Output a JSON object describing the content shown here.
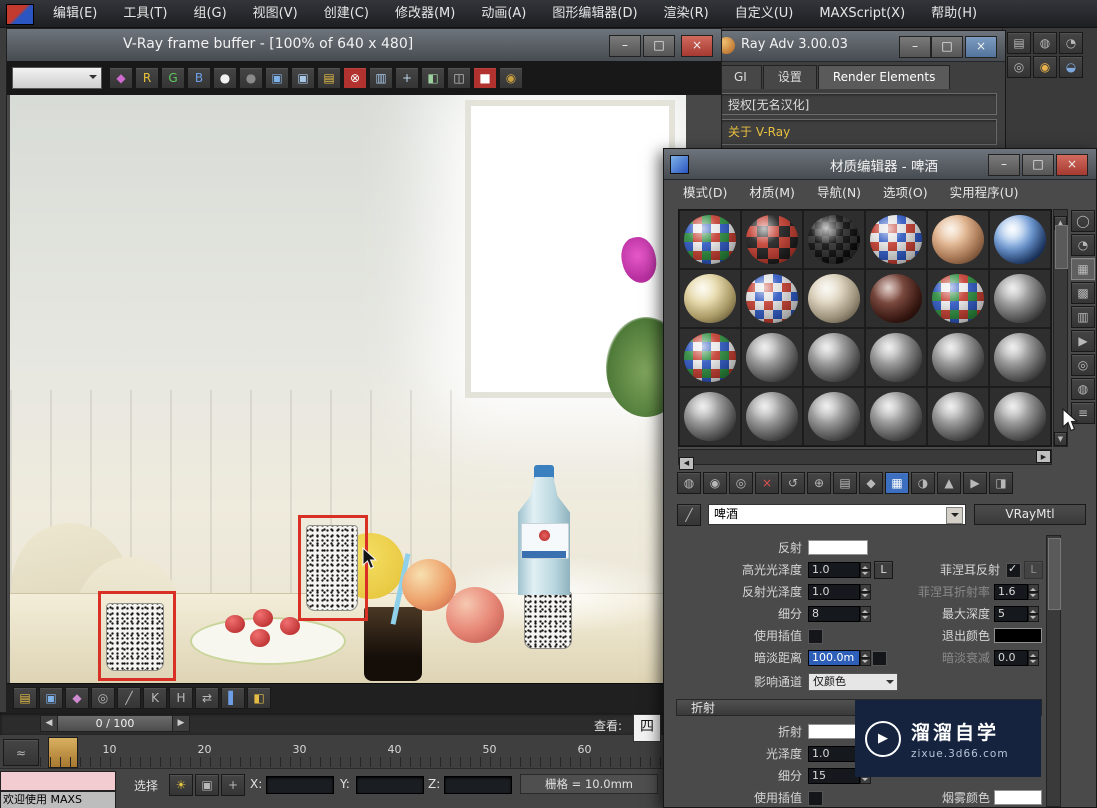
{
  "colors": {
    "accent_red": "#d93025",
    "selection_blue": "#2e5fb8",
    "watermark_bg": "#15233f"
  },
  "menubar": {
    "items": [
      "编辑(E)",
      "工具(T)",
      "组(G)",
      "视图(V)",
      "创建(C)",
      "修改器(M)",
      "动画(A)",
      "图形编辑器(D)",
      "渲染(R)",
      "自定义(U)",
      "MAXScript(X)",
      "帮助(H)"
    ]
  },
  "topright": {
    "icons": [
      {
        "name": "manage-layers-icon",
        "glyph": "▤"
      },
      {
        "name": "material-editor-icon",
        "glyph": "◍"
      },
      {
        "name": "arc-rotate-icon",
        "glyph": "◔"
      },
      {
        "name": "render-setup-icon",
        "glyph": "◎"
      },
      {
        "name": "render-production-icon",
        "glyph": "◉",
        "fg": "#e8b24a"
      },
      {
        "name": "render-iterative-icon",
        "glyph": "◒",
        "fg": "#7fa8e0"
      }
    ]
  },
  "vray": {
    "title": "Ray Adv 3.00.03",
    "buttons": {
      "min": "–",
      "max": "□",
      "close": "×"
    },
    "tabs": [
      "GI",
      "设置",
      "Render Elements"
    ],
    "license": "授权[无名汉化]",
    "about": "关于 V-Ray"
  },
  "framebuffer": {
    "title": "V-Ray frame buffer - [100% of 640 x 480]",
    "buttons": {
      "min": "–",
      "max": "□",
      "close": "×"
    },
    "toolbar": [
      {
        "name": "color-corrections-icon",
        "glyph": "◆",
        "fg": "#d06ad0"
      },
      {
        "name": "red-channel-button",
        "glyph": "R",
        "fg": "#e8c23a"
      },
      {
        "name": "green-channel-button",
        "glyph": "G",
        "fg": "#5fc75f"
      },
      {
        "name": "blue-channel-button",
        "glyph": "B",
        "fg": "#6d9fe8"
      },
      {
        "name": "monochromatic-button",
        "glyph": "●",
        "fg": "#f2f2f2"
      },
      {
        "name": "alpha-channel-button",
        "glyph": "●",
        "fg": "#8a8a8a"
      },
      {
        "name": "save-image-icon",
        "glyph": "▣",
        "fg": "#7fb2e8"
      },
      {
        "name": "save-all-channels-icon",
        "glyph": "▣",
        "fg": "#a8c8ea"
      },
      {
        "name": "load-image-icon",
        "glyph": "▤",
        "fg": "#e4bc45"
      },
      {
        "name": "clear-image-icon",
        "glyph": "⊗",
        "fg": "#ffffff",
        "bg": "#b23230"
      },
      {
        "name": "duplicate-to-host-icon",
        "glyph": "▥",
        "fg": "#a8c8e8"
      },
      {
        "name": "track-mouse-icon",
        "glyph": "+",
        "fg": "#bdd6ef"
      },
      {
        "name": "region-render-icon",
        "glyph": "◧",
        "fg": "#9fd09f"
      },
      {
        "name": "compare-ab-icon",
        "glyph": "◫",
        "fg": "#c8c8c8"
      },
      {
        "name": "stop-render-icon",
        "glyph": "■",
        "fg": "#ffffff",
        "bg": "#b23230"
      },
      {
        "name": "info-icon",
        "glyph": "◉",
        "fg": "#c8a040"
      }
    ],
    "bottom_toolbar": [
      {
        "name": "open-file-icon",
        "glyph": "▤",
        "fg": "#e4bc45"
      },
      {
        "name": "save-file-icon",
        "glyph": "▣",
        "fg": "#7fb2e8"
      },
      {
        "name": "color-sample-icon",
        "glyph": "◆",
        "fg": "#d08ad0"
      },
      {
        "name": "white-balance-icon",
        "glyph": "◎"
      },
      {
        "name": "pencil-icon",
        "glyph": "╱"
      },
      {
        "name": "black-level-icon",
        "glyph": "K"
      },
      {
        "name": "white-level-icon",
        "glyph": "H"
      },
      {
        "name": "swap-icon",
        "glyph": "⇄"
      },
      {
        "name": "levels-icon",
        "glyph": "▌",
        "fg": "#6d9fe8"
      },
      {
        "name": "split-icon",
        "glyph": "◧",
        "fg": "#e4bc45"
      }
    ]
  },
  "material_editor": {
    "title": "材质编辑器 - 啤酒",
    "buttons": {
      "min": "–",
      "max": "□",
      "close": "×"
    },
    "menus": [
      "模式(D)",
      "材质(M)",
      "导航(N)",
      "选项(O)",
      "实用程序(U)"
    ],
    "swatches": [
      "multi",
      "red",
      "dark",
      "bluechk",
      "peach",
      "shinyblue",
      "creamy",
      "bluechk",
      "cream",
      "darkred",
      "multi",
      "gray",
      "multi",
      "gray",
      "gray",
      "gray",
      "gray",
      "gray",
      "gray",
      "gray",
      "gray",
      "gray",
      "gray",
      "gray"
    ],
    "side_icons": [
      {
        "name": "sample-type-icon",
        "glyph": "◯"
      },
      {
        "name": "backlight-icon",
        "glyph": "◔"
      },
      {
        "name": "background-icon",
        "glyph": "▦",
        "cls": "active"
      },
      {
        "name": "sample-uv-tiling-icon",
        "glyph": "▩"
      },
      {
        "name": "video-color-check-icon",
        "glyph": "▥"
      },
      {
        "name": "make-preview-icon",
        "glyph": "▶"
      },
      {
        "name": "options-icon",
        "glyph": "◎"
      },
      {
        "name": "select-by-material-icon",
        "glyph": "◍"
      },
      {
        "name": "material-map-navigator-icon",
        "glyph": "≡"
      }
    ],
    "toolbar": [
      {
        "name": "get-material-icon",
        "glyph": "◍"
      },
      {
        "name": "put-to-scene-icon",
        "glyph": "◉"
      },
      {
        "name": "assign-to-selection-icon",
        "glyph": "◎"
      },
      {
        "name": "delete-material-icon",
        "glyph": "×",
        "fg": "#e05050"
      },
      {
        "name": "reset-swatch-icon",
        "glyph": "↺"
      },
      {
        "name": "make-unique-icon",
        "glyph": "⊕"
      },
      {
        "name": "put-to-library-icon",
        "glyph": "▤"
      },
      {
        "name": "material-id-channel-icon",
        "glyph": "◆"
      },
      {
        "name": "show-map-in-viewport-icon",
        "glyph": "▦",
        "cls": "active-blue"
      },
      {
        "name": "show-end-result-icon",
        "glyph": "◑"
      },
      {
        "name": "go-to-parent-icon",
        "glyph": "▲"
      },
      {
        "name": "go-forward-sibling-icon",
        "glyph": "▶"
      },
      {
        "name": "launch-navigator-icon",
        "glyph": "◨"
      }
    ],
    "eyedropper_glyph": "╱",
    "material_name": "啤酒",
    "material_type": "VRayMtl",
    "params": {
      "reflection_label": "反射",
      "highlight_glossiness_label": "高光光泽度",
      "highlight_glossiness": "1.0",
      "lock_label": "L",
      "fresnel_reflection_label": "菲涅耳反射",
      "reflect_glossiness_label": "反射光泽度",
      "reflect_glossiness": "1.0",
      "fresnel_ior_label": "菲涅耳折射率",
      "fresnel_ior": "1.6",
      "subdivs_label": "细分",
      "subdivs": "8",
      "max_depth_label": "最大深度",
      "max_depth": "5",
      "use_interpolation_label": "使用插值",
      "exit_color_label": "退出颜色",
      "dim_distance_label": "暗淡距离",
      "dim_distance": "100.0m",
      "dim_falloff_label": "暗淡衰减",
      "dim_falloff": "0.0",
      "affect_channels_label": "影响通道",
      "affect_channels_value": "仅颜色",
      "refraction_header": "折射",
      "refraction_label": "折射",
      "glossiness_label": "光泽度",
      "glossiness": "1.0",
      "refr_subdivs_label": "细分",
      "refr_subdivs": "15",
      "use_interpolation2_label": "使用插值",
      "fog_color_label": "烟雾颜色"
    }
  },
  "timeline": {
    "frame_range": "0 / 100",
    "ticks": [
      "10",
      "20",
      "30",
      "40",
      "50",
      "60"
    ],
    "view_label": "查看:",
    "view_value": "四"
  },
  "statusbar": {
    "icons": [
      {
        "name": "isolate-selection-icon",
        "glyph": "☀",
        "fg": "#e8c840"
      },
      {
        "name": "selection-lock-icon",
        "glyph": "▣"
      },
      {
        "name": "absolute-transform-icon",
        "glyph": "+"
      }
    ],
    "select_label": "选择",
    "x_label": "X:",
    "y_label": "Y:",
    "z_label": "Z:",
    "grid_label": "栅格 = 10.0mm",
    "welcome": "欢迎使用 MAXS"
  },
  "watermark": {
    "brand": "溜溜自学",
    "url": "zixue.3d66.com"
  }
}
